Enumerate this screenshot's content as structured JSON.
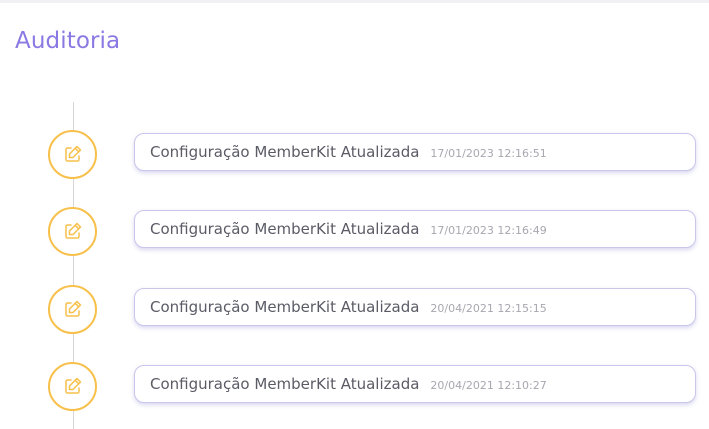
{
  "header": {
    "title": "Auditoria"
  },
  "timeline": {
    "entries": [
      {
        "icon": "edit-icon",
        "action": "Configuração MemberKit Atualizada",
        "timestamp": "17/01/2023 12:16:51"
      },
      {
        "icon": "edit-icon",
        "action": "Configuração MemberKit Atualizada",
        "timestamp": "17/01/2023 12:16:49"
      },
      {
        "icon": "edit-icon",
        "action": "Configuração MemberKit Atualizada",
        "timestamp": "20/04/2021 12:15:15"
      },
      {
        "icon": "edit-icon",
        "action": "Configuração MemberKit Atualizada",
        "timestamp": "20/04/2021 12:10:27"
      }
    ]
  },
  "colors": {
    "title": "#8a78e3",
    "node_border": "#f7c04a",
    "card_border": "#c9c6ea",
    "text": "#5b5b66",
    "timestamp": "#a7a7b0"
  }
}
